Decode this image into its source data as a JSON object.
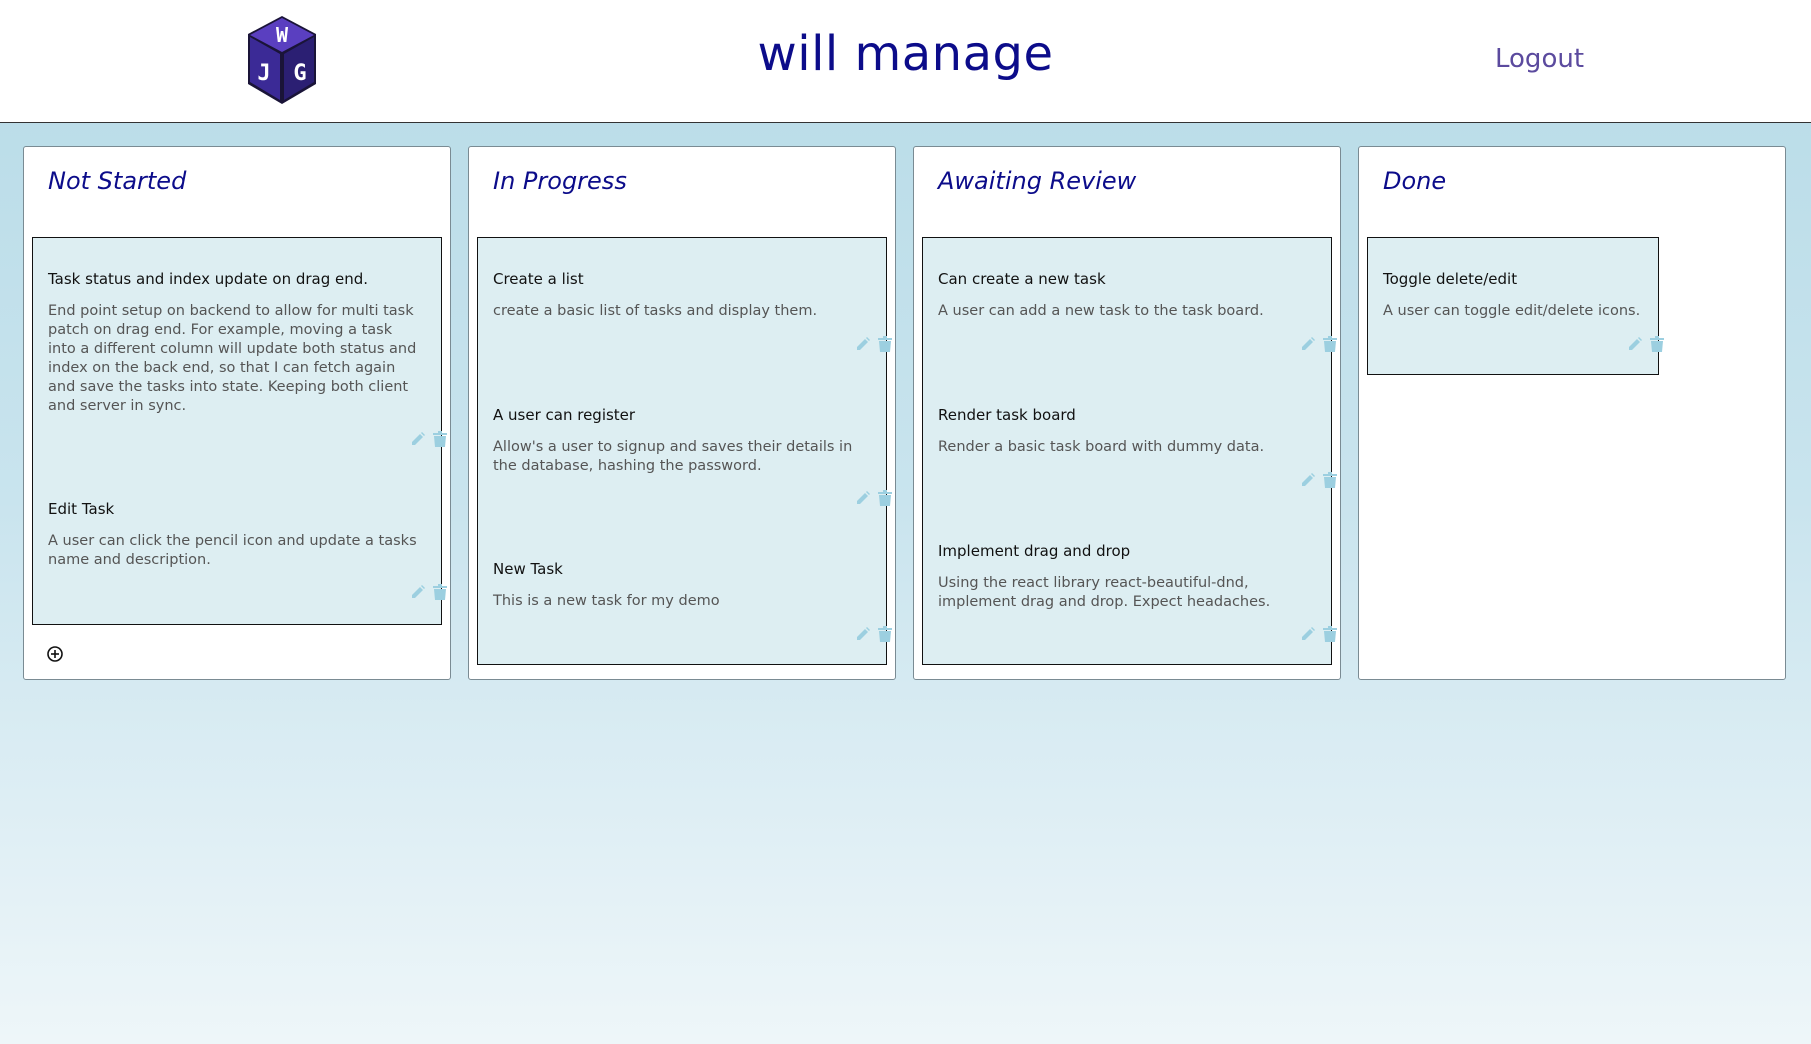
{
  "header": {
    "title": "will manage",
    "logout_label": "Logout",
    "logo_letters": "WJG"
  },
  "colors": {
    "title": "#0c0c8a",
    "logout": "#5b4a9e",
    "card_bg": "#ddeef2",
    "icon": "#9ccfe0",
    "page_bg_top": "#b7dbe7",
    "page_bg_bottom": "#eef6f9"
  },
  "board": {
    "add_task_icon": "plus-circle-icon",
    "columns": [
      {
        "title": "Not Started",
        "tasks": [
          {
            "name": "Task status and index update on drag end.",
            "description": "End point setup on backend to allow for multi task patch on drag end. For example, moving a task into a different column will update both status and index on the back end, so that I can fetch again and save the tasks into state. Keeping both client and server in sync."
          },
          {
            "name": "Edit Task",
            "description": "A user can click the pencil icon and update a tasks name and description."
          }
        ]
      },
      {
        "title": "In Progress",
        "tasks": [
          {
            "name": "Create a list",
            "description": "create a basic list of tasks and display them."
          },
          {
            "name": "A user can register",
            "description": "Allow's a user to signup and saves their details in the database, hashing the password."
          },
          {
            "name": "New Task",
            "description": "This is a new task for my demo"
          }
        ]
      },
      {
        "title": "Awaiting Review",
        "tasks": [
          {
            "name": "Can create a new task",
            "description": "A user can add a new task to the task board."
          },
          {
            "name": "Render task board",
            "description": "Render a basic task board with dummy data."
          },
          {
            "name": "Implement drag and drop",
            "description": "Using the react library react-beautiful-dnd, implement drag and drop. Expect headaches."
          }
        ]
      },
      {
        "title": "Done",
        "tasks": [
          {
            "name": "Toggle delete/edit",
            "description": "A user can toggle edit/delete icons."
          }
        ]
      }
    ]
  }
}
